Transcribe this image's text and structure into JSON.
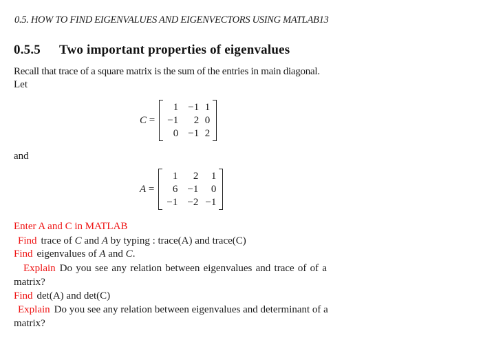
{
  "running_head": "0.5.  HOW TO FIND EIGENVALUES AND EIGENVECTORS USING MATLAB13",
  "section": {
    "number": "0.5.5",
    "title": "Two important properties of eigenvalues"
  },
  "intro": {
    "recall": "Recall that trace of a square matrix is the sum of the entries in main diagonal.",
    "let": "Let",
    "and": "and"
  },
  "matrices": {
    "C": {
      "name": "C",
      "equals": "=",
      "rows": [
        [
          "1",
          "−1",
          "1"
        ],
        [
          "−1",
          "2",
          "0"
        ],
        [
          "0",
          "−1",
          "2"
        ]
      ]
    },
    "A": {
      "name": "A",
      "equals": "=",
      "rows": [
        [
          "1",
          "2",
          "1"
        ],
        [
          "6",
          "−1",
          "0"
        ],
        [
          "−1",
          "−2",
          "−1"
        ]
      ]
    }
  },
  "tasks": {
    "enter": "Enter A and C in MATLAB",
    "find_trace": {
      "keyword": "Find",
      "text_1": "trace of ",
      "var_1": "C",
      "text_2": " and ",
      "var_2": "A",
      "text_3": " by typing : trace(A) and trace(C)"
    },
    "find_eig": {
      "keyword": "Find",
      "text_1": "eigenvalues of ",
      "var_1": "A",
      "text_2": " and ",
      "var_2": "C",
      "text_3": "."
    },
    "explain_trace": {
      "keyword": "Explain",
      "text": "Do you see any relation between eigenvalues and trace of of a",
      "continuation": "matrix?"
    },
    "find_det": {
      "keyword": "Find",
      "text": "det(A) and det(C)"
    },
    "explain_det": {
      "keyword": "Explain",
      "text": "Do you see any relation between eigenvalues and determinant of a",
      "continuation": "matrix?"
    }
  },
  "colors": {
    "keyword": "#ee1111",
    "text": "#1a1a1a"
  }
}
